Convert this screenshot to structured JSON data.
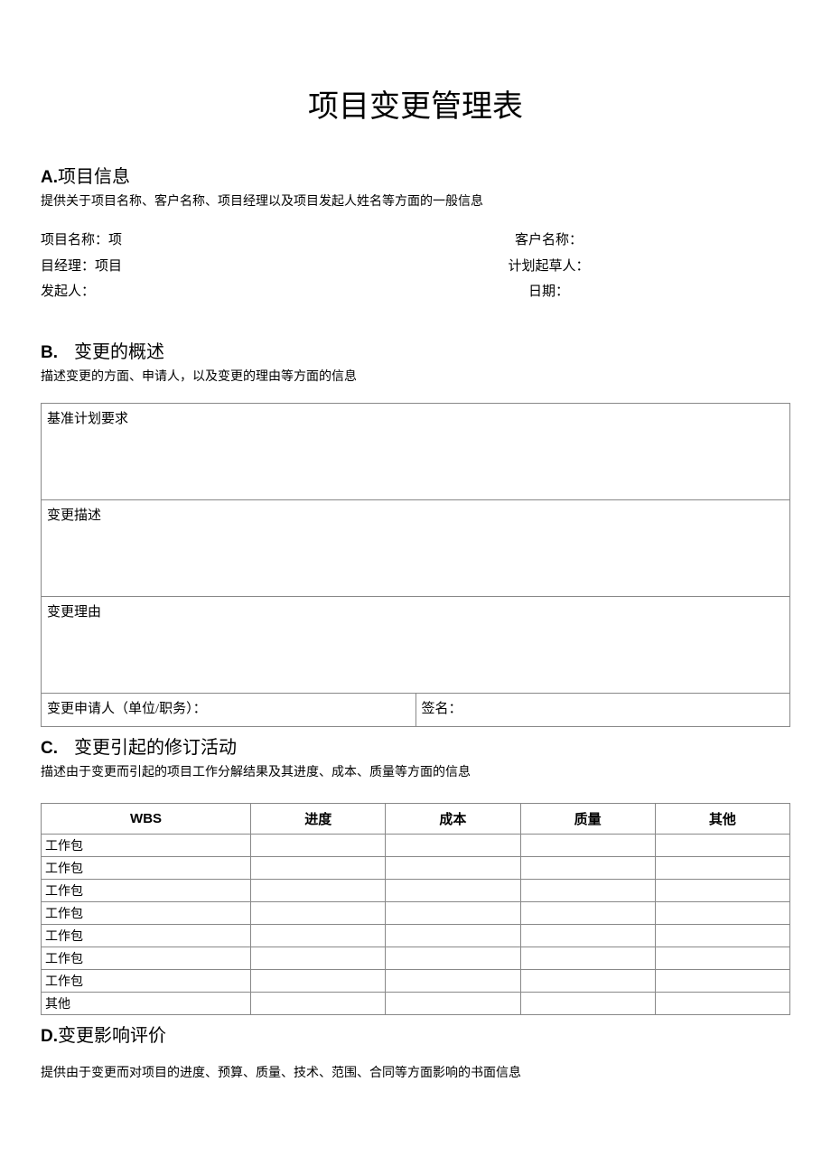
{
  "title": "项目变更管理表",
  "sectionA": {
    "letter": "A.",
    "name": "项目信息",
    "desc": "提供关于项目名称、客户名称、项目经理以及项目发起人姓名等方面的一般信息",
    "row1_left": "项目名称：项",
    "row1_right": "客户名称：",
    "row2_left": "目经理：项目",
    "row2_right": "计划起草人：",
    "row3_left": "发起人：",
    "row3_right": "日期："
  },
  "sectionB": {
    "letter": "B.",
    "name": "变更的概述",
    "desc": "描述变更的方面、申请人，以及变更的理由等方面的信息",
    "r1": "基准计划要求",
    "r2": "变更描述",
    "r3": "变更理由",
    "r4a": "变更申请人（单位/职务）：",
    "r4b": "签名："
  },
  "sectionC": {
    "letter": "C.",
    "name": "变更引起的修订活动",
    "desc": "描述由于变更而引起的项目工作分解结果及其进度、成本、质量等方面的信息",
    "headers": [
      "WBS",
      "进度",
      "成本",
      "质量",
      "其他"
    ],
    "rows": [
      "工作包",
      "工作包",
      "工作包",
      "工作包",
      "工作包",
      "工作包",
      "工作包",
      "其他"
    ]
  },
  "sectionD": {
    "letter": "D.",
    "name": "变更影响评价",
    "desc": "提供由于变更而对项目的进度、预算、质量、技术、范围、合同等方面影响的书面信息"
  }
}
